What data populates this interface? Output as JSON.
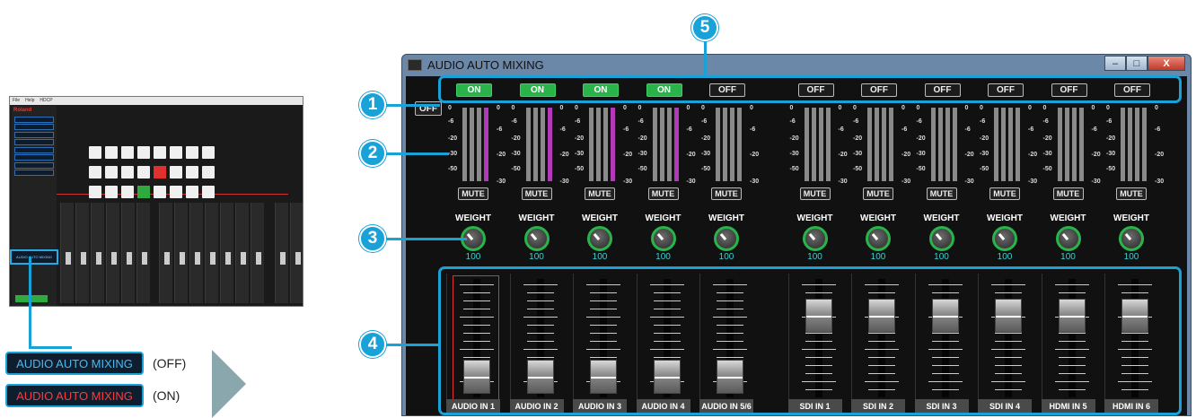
{
  "mini": {
    "menu": [
      "File",
      "Help",
      "HDCP"
    ],
    "brand": "Roland",
    "highlight_label": "AUDIO AUTO MIXING"
  },
  "states": [
    {
      "label": "AUDIO AUTO MIXING",
      "note": "(OFF)",
      "color": "#4ab8ee"
    },
    {
      "label": "AUDIO AUTO MIXING",
      "note": "(ON)",
      "color": "#ff3a3a"
    }
  ],
  "window": {
    "title": "AUDIO AUTO MIXING",
    "minimize": "–",
    "maximize": "□",
    "close": "X",
    "master_off": "OFF"
  },
  "meter_scale_left": [
    "0",
    "-6",
    "-20",
    "-30",
    "-50"
  ],
  "meter_scale_right": [
    "0",
    "-6",
    "-20",
    "-30"
  ],
  "mute_label": "MUTE",
  "weight_label": "WEIGHT",
  "channels": [
    {
      "name": "AUDIO IN 1",
      "state": "ON",
      "weight": "100",
      "fader": 0.1,
      "selected": true
    },
    {
      "name": "AUDIO IN 2",
      "state": "ON",
      "weight": "100",
      "fader": 0.1,
      "selected": false
    },
    {
      "name": "AUDIO IN 3",
      "state": "ON",
      "weight": "100",
      "fader": 0.1,
      "selected": false
    },
    {
      "name": "AUDIO IN 4",
      "state": "ON",
      "weight": "100",
      "fader": 0.1,
      "selected": false
    },
    {
      "name": "AUDIO IN 5/6",
      "state": "OFF",
      "weight": "100",
      "fader": 0.1,
      "selected": false
    },
    {
      "name": "SDI IN 1",
      "state": "OFF",
      "weight": "100",
      "fader": 0.78,
      "selected": false
    },
    {
      "name": "SDI IN 2",
      "state": "OFF",
      "weight": "100",
      "fader": 0.78,
      "selected": false
    },
    {
      "name": "SDI IN 3",
      "state": "OFF",
      "weight": "100",
      "fader": 0.78,
      "selected": false
    },
    {
      "name": "SDI IN 4",
      "state": "OFF",
      "weight": "100",
      "fader": 0.78,
      "selected": false
    },
    {
      "name": "HDMI IN 5",
      "state": "OFF",
      "weight": "100",
      "fader": 0.78,
      "selected": false
    },
    {
      "name": "HDMI IN 6",
      "state": "OFF",
      "weight": "100",
      "fader": 0.78,
      "selected": false
    }
  ],
  "callouts": [
    "1",
    "2",
    "3",
    "4",
    "5"
  ],
  "colors": {
    "accent": "#19a2d8",
    "on": "#2ab34a",
    "peak": "#b23ab8"
  }
}
